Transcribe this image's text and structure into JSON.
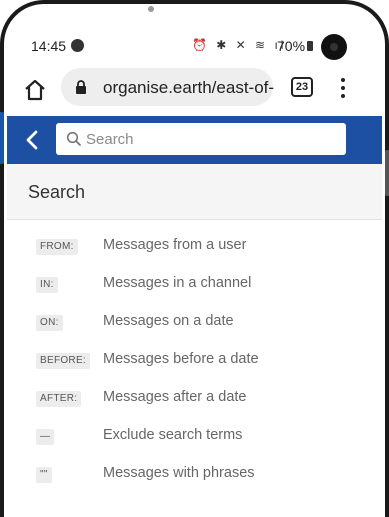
{
  "status_bar": {
    "time": "14:45",
    "icons_text": "⏰ ✱ ✕ ≋ ıl",
    "battery_pct": "70%"
  },
  "browser": {
    "url": "organise.earth/east-of-",
    "tab_count": "23"
  },
  "app": {
    "search_placeholder": "Search",
    "section_title": "Search"
  },
  "hints": [
    {
      "tag": "FROM:",
      "desc": "Messages from a user"
    },
    {
      "tag": "IN:",
      "desc": "Messages in a channel"
    },
    {
      "tag": "ON:",
      "desc": "Messages on a date"
    },
    {
      "tag": "BEFORE:",
      "desc": "Messages before a date"
    },
    {
      "tag": "AFTER:",
      "desc": "Messages after a date"
    },
    {
      "tag": "—",
      "desc": "Exclude search terms"
    },
    {
      "tag": "\"\"",
      "desc": "Messages with phrases"
    }
  ],
  "colors": {
    "header_blue": "#1d4fa3",
    "section_bg": "#f5f5f5"
  }
}
